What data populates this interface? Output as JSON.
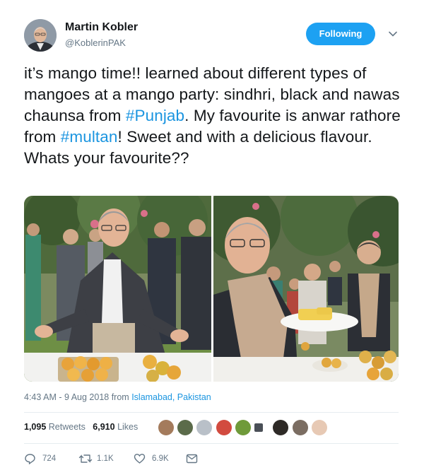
{
  "user": {
    "name": "Martin Kobler",
    "handle": "@KoblerinPAK",
    "follow_label": "Following"
  },
  "tweet": {
    "segments": [
      {
        "text": "it’s mango time!! learned about different types of mangoes at a mango party: sindhri, black and nawas chaunsa from ",
        "hashtag": false
      },
      {
        "text": "#Punjab",
        "hashtag": true
      },
      {
        "text": ". My favourite is anwar rathore from ",
        "hashtag": false
      },
      {
        "text": "#multan",
        "hashtag": true
      },
      {
        "text": "! Sweet and with a delicious flavour. Whats your favourite??",
        "hashtag": false
      }
    ]
  },
  "meta": {
    "time": "4:43 AM - 9 Aug 2018 from ",
    "place": "Islamabad, Pakistan"
  },
  "stats": {
    "retweets_count": "1,095",
    "retweets_label": "Retweets",
    "likes_count": "6,910",
    "likes_label": "Likes"
  },
  "actions": {
    "replies": "724",
    "retweets": "1.1K",
    "likes": "6.9K"
  },
  "colors": {
    "accent": "#1da1f2",
    "link": "#1b95e0",
    "secondary_text": "#657786"
  },
  "icons": {
    "caret": "chevron-down-icon",
    "reply": "reply-icon",
    "retweet": "retweet-icon",
    "like": "heart-icon",
    "dm": "envelope-icon"
  }
}
